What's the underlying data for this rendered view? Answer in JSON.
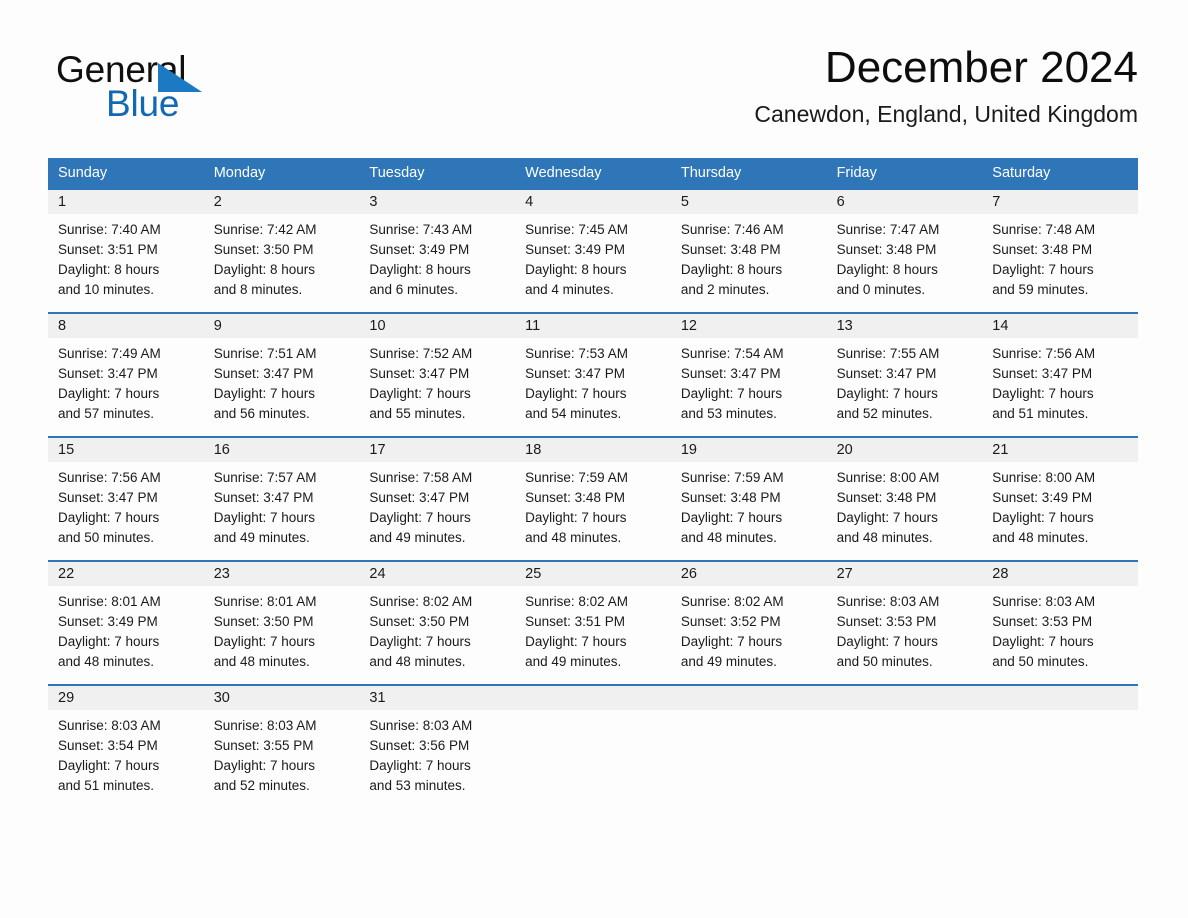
{
  "brand": {
    "name_part1": "General",
    "name_part2": "Blue",
    "accent_color": "#1268b3"
  },
  "header": {
    "title": "December 2024",
    "subtitle": "Canewdon, England, United Kingdom"
  },
  "theme": {
    "header_blue": "#2e76b8",
    "date_band_gray": "#f0f0f0",
    "page_background": "#fdfdfd"
  },
  "weekdays": [
    "Sunday",
    "Monday",
    "Tuesday",
    "Wednesday",
    "Thursday",
    "Friday",
    "Saturday"
  ],
  "weeks": [
    {
      "days": [
        {
          "date": "1",
          "sunrise": "Sunrise: 7:40 AM",
          "sunset": "Sunset: 3:51 PM",
          "daylight_line1": "Daylight: 8 hours",
          "daylight_line2": "and 10 minutes."
        },
        {
          "date": "2",
          "sunrise": "Sunrise: 7:42 AM",
          "sunset": "Sunset: 3:50 PM",
          "daylight_line1": "Daylight: 8 hours",
          "daylight_line2": "and 8 minutes."
        },
        {
          "date": "3",
          "sunrise": "Sunrise: 7:43 AM",
          "sunset": "Sunset: 3:49 PM",
          "daylight_line1": "Daylight: 8 hours",
          "daylight_line2": "and 6 minutes."
        },
        {
          "date": "4",
          "sunrise": "Sunrise: 7:45 AM",
          "sunset": "Sunset: 3:49 PM",
          "daylight_line1": "Daylight: 8 hours",
          "daylight_line2": "and 4 minutes."
        },
        {
          "date": "5",
          "sunrise": "Sunrise: 7:46 AM",
          "sunset": "Sunset: 3:48 PM",
          "daylight_line1": "Daylight: 8 hours",
          "daylight_line2": "and 2 minutes."
        },
        {
          "date": "6",
          "sunrise": "Sunrise: 7:47 AM",
          "sunset": "Sunset: 3:48 PM",
          "daylight_line1": "Daylight: 8 hours",
          "daylight_line2": "and 0 minutes."
        },
        {
          "date": "7",
          "sunrise": "Sunrise: 7:48 AM",
          "sunset": "Sunset: 3:48 PM",
          "daylight_line1": "Daylight: 7 hours",
          "daylight_line2": "and 59 minutes."
        }
      ]
    },
    {
      "days": [
        {
          "date": "8",
          "sunrise": "Sunrise: 7:49 AM",
          "sunset": "Sunset: 3:47 PM",
          "daylight_line1": "Daylight: 7 hours",
          "daylight_line2": "and 57 minutes."
        },
        {
          "date": "9",
          "sunrise": "Sunrise: 7:51 AM",
          "sunset": "Sunset: 3:47 PM",
          "daylight_line1": "Daylight: 7 hours",
          "daylight_line2": "and 56 minutes."
        },
        {
          "date": "10",
          "sunrise": "Sunrise: 7:52 AM",
          "sunset": "Sunset: 3:47 PM",
          "daylight_line1": "Daylight: 7 hours",
          "daylight_line2": "and 55 minutes."
        },
        {
          "date": "11",
          "sunrise": "Sunrise: 7:53 AM",
          "sunset": "Sunset: 3:47 PM",
          "daylight_line1": "Daylight: 7 hours",
          "daylight_line2": "and 54 minutes."
        },
        {
          "date": "12",
          "sunrise": "Sunrise: 7:54 AM",
          "sunset": "Sunset: 3:47 PM",
          "daylight_line1": "Daylight: 7 hours",
          "daylight_line2": "and 53 minutes."
        },
        {
          "date": "13",
          "sunrise": "Sunrise: 7:55 AM",
          "sunset": "Sunset: 3:47 PM",
          "daylight_line1": "Daylight: 7 hours",
          "daylight_line2": "and 52 minutes."
        },
        {
          "date": "14",
          "sunrise": "Sunrise: 7:56 AM",
          "sunset": "Sunset: 3:47 PM",
          "daylight_line1": "Daylight: 7 hours",
          "daylight_line2": "and 51 minutes."
        }
      ]
    },
    {
      "days": [
        {
          "date": "15",
          "sunrise": "Sunrise: 7:56 AM",
          "sunset": "Sunset: 3:47 PM",
          "daylight_line1": "Daylight: 7 hours",
          "daylight_line2": "and 50 minutes."
        },
        {
          "date": "16",
          "sunrise": "Sunrise: 7:57 AM",
          "sunset": "Sunset: 3:47 PM",
          "daylight_line1": "Daylight: 7 hours",
          "daylight_line2": "and 49 minutes."
        },
        {
          "date": "17",
          "sunrise": "Sunrise: 7:58 AM",
          "sunset": "Sunset: 3:47 PM",
          "daylight_line1": "Daylight: 7 hours",
          "daylight_line2": "and 49 minutes."
        },
        {
          "date": "18",
          "sunrise": "Sunrise: 7:59 AM",
          "sunset": "Sunset: 3:48 PM",
          "daylight_line1": "Daylight: 7 hours",
          "daylight_line2": "and 48 minutes."
        },
        {
          "date": "19",
          "sunrise": "Sunrise: 7:59 AM",
          "sunset": "Sunset: 3:48 PM",
          "daylight_line1": "Daylight: 7 hours",
          "daylight_line2": "and 48 minutes."
        },
        {
          "date": "20",
          "sunrise": "Sunrise: 8:00 AM",
          "sunset": "Sunset: 3:48 PM",
          "daylight_line1": "Daylight: 7 hours",
          "daylight_line2": "and 48 minutes."
        },
        {
          "date": "21",
          "sunrise": "Sunrise: 8:00 AM",
          "sunset": "Sunset: 3:49 PM",
          "daylight_line1": "Daylight: 7 hours",
          "daylight_line2": "and 48 minutes."
        }
      ]
    },
    {
      "days": [
        {
          "date": "22",
          "sunrise": "Sunrise: 8:01 AM",
          "sunset": "Sunset: 3:49 PM",
          "daylight_line1": "Daylight: 7 hours",
          "daylight_line2": "and 48 minutes."
        },
        {
          "date": "23",
          "sunrise": "Sunrise: 8:01 AM",
          "sunset": "Sunset: 3:50 PM",
          "daylight_line1": "Daylight: 7 hours",
          "daylight_line2": "and 48 minutes."
        },
        {
          "date": "24",
          "sunrise": "Sunrise: 8:02 AM",
          "sunset": "Sunset: 3:50 PM",
          "daylight_line1": "Daylight: 7 hours",
          "daylight_line2": "and 48 minutes."
        },
        {
          "date": "25",
          "sunrise": "Sunrise: 8:02 AM",
          "sunset": "Sunset: 3:51 PM",
          "daylight_line1": "Daylight: 7 hours",
          "daylight_line2": "and 49 minutes."
        },
        {
          "date": "26",
          "sunrise": "Sunrise: 8:02 AM",
          "sunset": "Sunset: 3:52 PM",
          "daylight_line1": "Daylight: 7 hours",
          "daylight_line2": "and 49 minutes."
        },
        {
          "date": "27",
          "sunrise": "Sunrise: 8:03 AM",
          "sunset": "Sunset: 3:53 PM",
          "daylight_line1": "Daylight: 7 hours",
          "daylight_line2": "and 50 minutes."
        },
        {
          "date": "28",
          "sunrise": "Sunrise: 8:03 AM",
          "sunset": "Sunset: 3:53 PM",
          "daylight_line1": "Daylight: 7 hours",
          "daylight_line2": "and 50 minutes."
        }
      ]
    },
    {
      "days": [
        {
          "date": "29",
          "sunrise": "Sunrise: 8:03 AM",
          "sunset": "Sunset: 3:54 PM",
          "daylight_line1": "Daylight: 7 hours",
          "daylight_line2": "and 51 minutes."
        },
        {
          "date": "30",
          "sunrise": "Sunrise: 8:03 AM",
          "sunset": "Sunset: 3:55 PM",
          "daylight_line1": "Daylight: 7 hours",
          "daylight_line2": "and 52 minutes."
        },
        {
          "date": "31",
          "sunrise": "Sunrise: 8:03 AM",
          "sunset": "Sunset: 3:56 PM",
          "daylight_line1": "Daylight: 7 hours",
          "daylight_line2": "and 53 minutes."
        },
        {
          "date": "",
          "sunrise": "",
          "sunset": "",
          "daylight_line1": "",
          "daylight_line2": ""
        },
        {
          "date": "",
          "sunrise": "",
          "sunset": "",
          "daylight_line1": "",
          "daylight_line2": ""
        },
        {
          "date": "",
          "sunrise": "",
          "sunset": "",
          "daylight_line1": "",
          "daylight_line2": ""
        },
        {
          "date": "",
          "sunrise": "",
          "sunset": "",
          "daylight_line1": "",
          "daylight_line2": ""
        }
      ]
    }
  ]
}
